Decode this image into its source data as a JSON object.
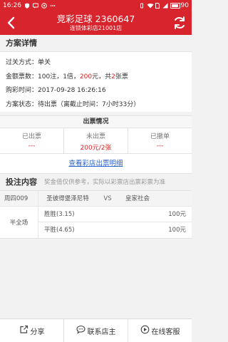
{
  "status_bar": {
    "time": "16:26",
    "battery": "90",
    "battery_level": 0.9
  },
  "header": {
    "title": "竞彩足球",
    "number": "2360647",
    "subtitle": "连锁体彩店21001店"
  },
  "plan_section": {
    "title": "方案详情"
  },
  "plan": {
    "pass_label": "过关方式：",
    "pass_value": "单关",
    "amount_label": "金额票数：",
    "amount_prefix": "100注，1倍，",
    "amount_value": "200",
    "amount_unit": "元，共",
    "ticket_count": "2",
    "ticket_unit": "张票",
    "time_label": "购彩时间：",
    "time_value": "2017-09-28 16:26:16",
    "status_label": "方案状态：",
    "status_value": "待出票（离截止时间：7小时33分）"
  },
  "tickets": {
    "title": "出票情况",
    "columns": [
      {
        "label": "已出票",
        "value": "---"
      },
      {
        "label": "未出票",
        "value": "200元/2张"
      },
      {
        "label": "已撤单",
        "value": "---"
      }
    ],
    "detail_link": "查看彩店出票明细"
  },
  "bet": {
    "title": "投注内容",
    "note": "奖金值仅供参考，实际以彩票店出票彩票为准",
    "match": {
      "code": "周四009",
      "home": "圣彼得堡泽尼特",
      "vs": "VS",
      "away": "皇家社会"
    },
    "type_label": "半全场",
    "options": [
      {
        "name": "胜胜(3.15)",
        "amount": "100元"
      },
      {
        "name": "平胜(4.65)",
        "amount": "100元"
      }
    ]
  },
  "bottom": {
    "share": "分享",
    "contact": "联系店主",
    "service": "在线客服"
  }
}
